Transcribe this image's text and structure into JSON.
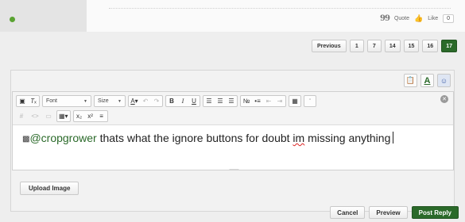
{
  "post": {
    "quote_icon": "quote-icon",
    "quote_label": "Quote",
    "like_label": "Like",
    "like_count": "0"
  },
  "pagination": {
    "previous": "Previous",
    "pages": [
      "1",
      "7",
      "14",
      "15",
      "16"
    ],
    "current": "17"
  },
  "editor": {
    "toolbar": {
      "font_label": "Font",
      "size_label": "Size"
    },
    "content": {
      "mention": "@cropgrower",
      "text_before_spell": " thats what the ignore buttons for doubt ",
      "misspelled": "im",
      "text_after_spell": " missing anything"
    },
    "upload_label": "Upload Image"
  },
  "actions": {
    "cancel": "Cancel",
    "preview": "Preview",
    "post_reply": "Post Reply"
  },
  "colors": {
    "accent": "#2b6a2a",
    "online": "#5aa332"
  }
}
